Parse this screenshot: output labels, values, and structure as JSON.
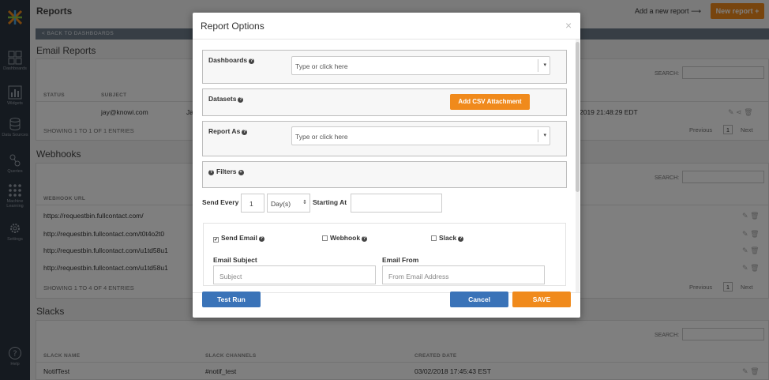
{
  "sidebar": {
    "items": [
      {
        "label": "Dashboards",
        "icon": "grid-icon"
      },
      {
        "label": "Widgets",
        "icon": "bar-chart-icon"
      },
      {
        "label": "Data Sources",
        "icon": "database-icon"
      },
      {
        "label": "Queries",
        "icon": "queries-icon"
      },
      {
        "label": "Machine Learning",
        "icon": "network-icon"
      },
      {
        "label": "Settings",
        "icon": "gear-icon"
      },
      {
        "label": "Help",
        "icon": "help-icon"
      }
    ]
  },
  "header": {
    "title": "Reports",
    "add_new_report": "Add a new report",
    "new_report_button": "New report +",
    "back_link": "< BACK TO DASHBOARDS"
  },
  "email_reports": {
    "title": "Email Reports",
    "search_label": "SEARCH:",
    "columns": [
      "STATUS",
      "SUBJECT"
    ],
    "row": {
      "subject": "jay@knowi.com",
      "subject_cont": "Ja",
      "timestamp": "2019 21:48:29 EDT"
    },
    "entries_info": "SHOWING 1 TO 1 OF 1 ENTRIES",
    "pager": {
      "prev": "Previous",
      "page": "1",
      "next": "Next"
    }
  },
  "webhooks": {
    "title": "Webhooks",
    "search_label": "SEARCH:",
    "column": "WEBHOOK URL",
    "rows": [
      "https://requestbin.fullcontact.com/",
      "http://requestbin.fullcontact.com/t0t4o2t0",
      "http://requestbin.fullcontact.com/u1td58u1",
      "http://requestbin.fullcontact.com/u1td58u1"
    ],
    "entries_info": "SHOWING 1 TO 4 OF 4 ENTRIES",
    "pager": {
      "prev": "Previous",
      "page": "1",
      "next": "Next"
    }
  },
  "slacks": {
    "title": "Slacks",
    "search_label": "SEARCH:",
    "columns": [
      "SLACK NAME",
      "SLACK CHANNELS",
      "CREATED DATE"
    ],
    "row": {
      "name": "NotifTest",
      "channel": "#notif_test",
      "created": "03/02/2018 17:45:43 EST"
    }
  },
  "modal": {
    "title": "Report Options",
    "close": "×",
    "dashboards": {
      "label": "Dashboards",
      "placeholder": "Type or click here"
    },
    "datasets": {
      "label": "Datasets",
      "csv_button": "Add CSV Attachment"
    },
    "report_as": {
      "label": "Report As",
      "placeholder": "Type or click here"
    },
    "filters": {
      "label": "Filters"
    },
    "schedule": {
      "send_every_label": "Send Every",
      "send_every_value": "1",
      "unit": "Day(s)",
      "starting_at_label": "Starting At",
      "starting_at_value": ""
    },
    "send_email": {
      "label": "Send Email",
      "checked": true
    },
    "webhook": {
      "label": "Webhook",
      "checked": false
    },
    "slack": {
      "label": "Slack",
      "checked": false
    },
    "email_subject": {
      "label": "Email Subject",
      "placeholder": "Subject"
    },
    "email_from": {
      "label": "Email From",
      "placeholder": "From Email Address"
    },
    "test_run_button": "Test Run",
    "cancel_button": "Cancel",
    "save_button": "SAVE"
  },
  "colors": {
    "accent_orange": "#f08a1c",
    "primary_blue": "#3a73b8",
    "sidebar_bg": "#2b3440"
  }
}
